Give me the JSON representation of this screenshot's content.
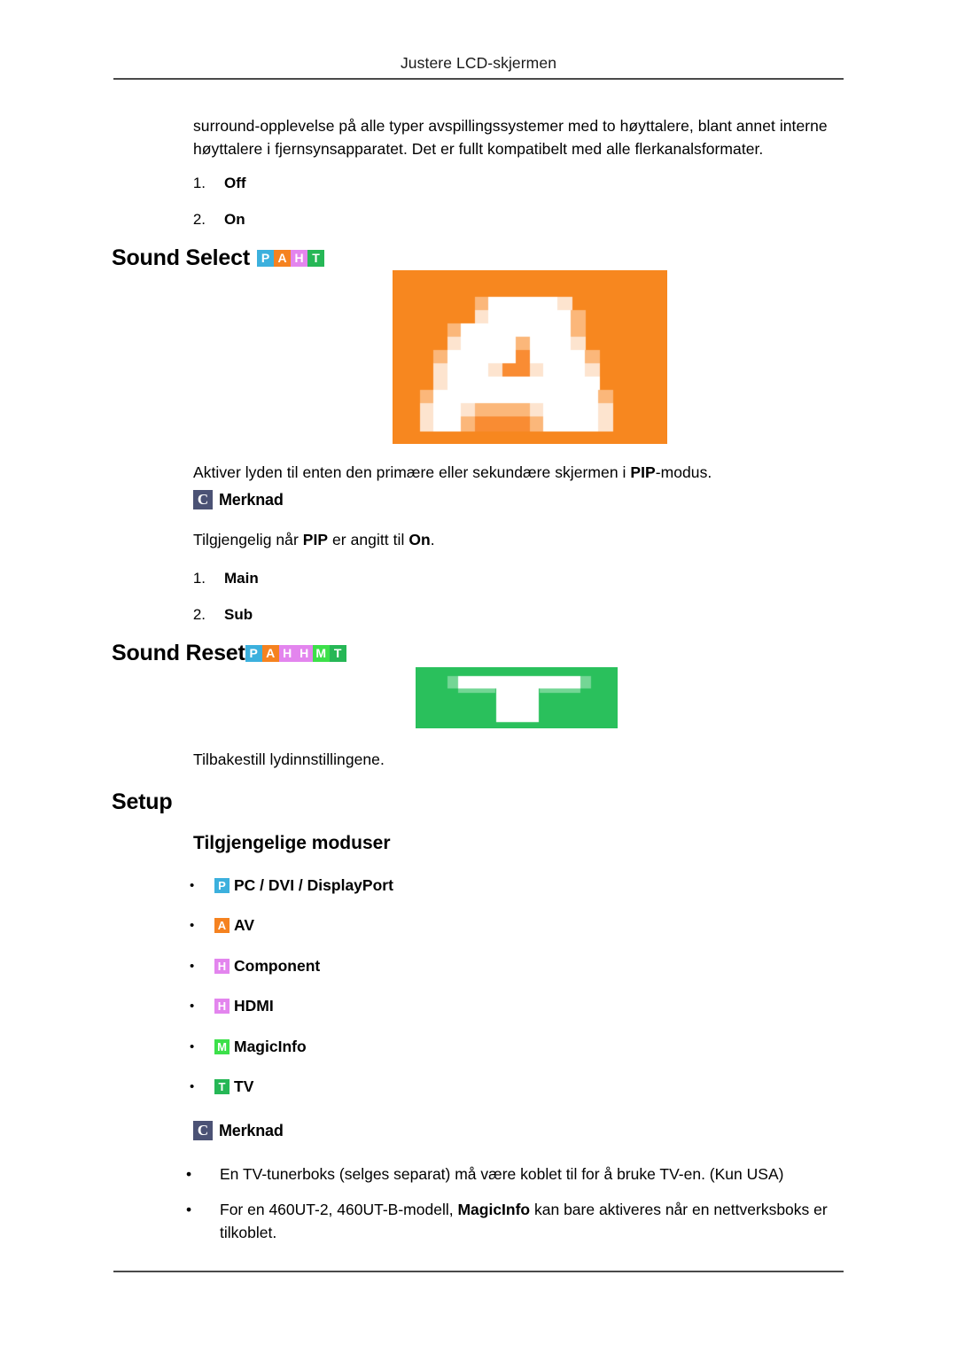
{
  "header": {
    "title": "Justere LCD-skjermen"
  },
  "intro": {
    "paragraph": "surround-opplevelse på alle typer avspillingssystemer med to høyttalere, blant annet interne høyttalere i fjernsynsapparatet. Det er fullt kompatibelt med alle flerkanalsformater."
  },
  "onoff_list": [
    {
      "num": "1.",
      "label": "Off"
    },
    {
      "num": "2.",
      "label": "On"
    }
  ],
  "sound_select": {
    "heading": "Sound Select",
    "badges": [
      {
        "letter": "P",
        "color": "#3cb0dd"
      },
      {
        "letter": "A",
        "color": "#f58220"
      },
      {
        "letter": "H",
        "color": "#e385ee"
      },
      {
        "letter": "T",
        "color": "#26b756"
      }
    ],
    "figure": {
      "name": "sound-select-screenshot",
      "letter": "A",
      "background": "#f7871f",
      "foreground": "#ffffff"
    },
    "description_before": "Aktiver lyden til enten den primære eller sekundære skjermen i ",
    "description_bold": "PIP",
    "description_after": "-modus.",
    "note": {
      "icon": "C",
      "label": "Merknad",
      "text_before": "Tilgjengelig når ",
      "text_bold1": "PIP",
      "text_middle": " er angitt til ",
      "text_bold2": "On",
      "text_after": "."
    },
    "options": [
      {
        "num": "1.",
        "label": "Main"
      },
      {
        "num": "2.",
        "label": "Sub"
      }
    ]
  },
  "sound_reset": {
    "heading": "Sound Reset",
    "badges": [
      {
        "letter": "P",
        "color": "#3cb0dd"
      },
      {
        "letter": "A",
        "color": "#f58220"
      },
      {
        "letter": "H",
        "color": "#e385ee"
      },
      {
        "letter": "H",
        "color": "#e385ee"
      },
      {
        "letter": "M",
        "color": "#3ce04a"
      },
      {
        "letter": "T",
        "color": "#26b756"
      }
    ],
    "figure": {
      "name": "sound-reset-screenshot",
      "letter": "T",
      "background": "#2ac05c",
      "foreground": "#ffffff"
    },
    "description": "Tilbakestill lydinnstillingene."
  },
  "setup": {
    "heading": "Setup",
    "subheading": "Tilgjengelige moduser",
    "modes": [
      {
        "badge": "P",
        "color": "#3cb0dd",
        "label": "PC / DVI / DisplayPort"
      },
      {
        "badge": "A",
        "color": "#f58220",
        "label": "AV"
      },
      {
        "badge": "H",
        "color": "#e385ee",
        "label": "Component"
      },
      {
        "badge": "H",
        "color": "#e385ee",
        "label": "HDMI"
      },
      {
        "badge": "M",
        "color": "#3ce04a",
        "label": "MagicInfo"
      },
      {
        "badge": "T",
        "color": "#26b756",
        "label": "TV"
      }
    ],
    "note": {
      "icon": "C",
      "label": "Merknad"
    },
    "notes": [
      {
        "text": "En TV-tunerboks (selges separat) må være koblet til for å bruke TV-en. (Kun USA)"
      },
      {
        "before": "For en 460UT-2, 460UT-B-modell, ",
        "bold": "MagicInfo",
        "after": " kan bare aktiveres når en nettverksboks er tilkoblet."
      }
    ]
  },
  "bullet_glyph": "•"
}
